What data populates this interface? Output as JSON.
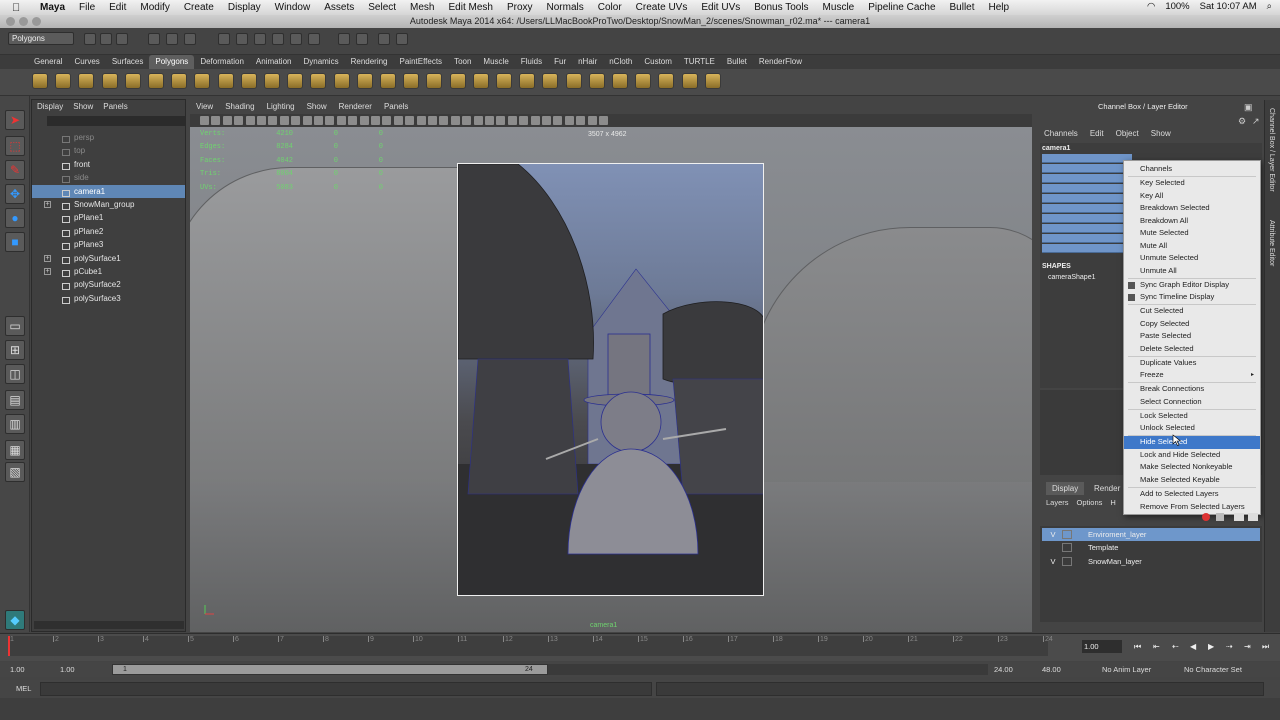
{
  "mac_menu": {
    "app": "Maya",
    "items": [
      "File",
      "Edit",
      "Modify",
      "Create",
      "Display",
      "Window",
      "Assets",
      "Select",
      "Mesh",
      "Edit Mesh",
      "Proxy",
      "Normals",
      "Color",
      "Create UVs",
      "Edit UVs",
      "Bonus Tools",
      "Muscle",
      "Pipeline Cache",
      "Bullet",
      "Help"
    ],
    "battery": "100%",
    "clock": "Sat 10:07 AM"
  },
  "window_title": "Autodesk Maya 2014 x64: /Users/LLMacBookProTwo/Desktop/SnowMan_2/scenes/Snowman_r02.ma*  ---  camera1",
  "mode_menu": "Polygons",
  "shelf_tabs": [
    "General",
    "Curves",
    "Surfaces",
    "Polygons",
    "Deformation",
    "Animation",
    "Dynamics",
    "Rendering",
    "PaintEffects",
    "Toon",
    "Muscle",
    "Fluids",
    "Fur",
    "nHair",
    "nCloth",
    "Custom",
    "TURTLE",
    "Bullet",
    "RenderFlow"
  ],
  "active_shelf_tab": "Polygons",
  "outliner": {
    "menu": [
      "Display",
      "Show",
      "Panels"
    ],
    "items": [
      {
        "label": "persp",
        "state": "dim",
        "expand": false
      },
      {
        "label": "top",
        "state": "dim",
        "expand": false
      },
      {
        "label": "front",
        "state": "normal",
        "expand": false
      },
      {
        "label": "side",
        "state": "dim",
        "expand": false
      },
      {
        "label": "camera1",
        "state": "selected",
        "expand": false
      },
      {
        "label": "SnowMan_group",
        "state": "normal",
        "expand": true
      },
      {
        "label": "pPlane1",
        "state": "normal",
        "expand": false
      },
      {
        "label": "pPlane2",
        "state": "normal",
        "expand": false
      },
      {
        "label": "pPlane3",
        "state": "normal",
        "expand": false
      },
      {
        "label": "polySurface1",
        "state": "normal",
        "expand": true
      },
      {
        "label": "pCube1",
        "state": "normal",
        "expand": true
      },
      {
        "label": "polySurface2",
        "state": "normal",
        "expand": false
      },
      {
        "label": "polySurface3",
        "state": "normal",
        "expand": false
      }
    ],
    "expand_glyph": "+"
  },
  "viewport": {
    "menu": [
      "View",
      "Shading",
      "Lighting",
      "Show",
      "Renderer",
      "Panels"
    ],
    "hud": [
      {
        "label": "Verts:",
        "v1": "4210",
        "v2": "0",
        "v3": "0"
      },
      {
        "label": "Edges:",
        "v1": "8284",
        "v2": "0",
        "v3": "0"
      },
      {
        "label": "Faces:",
        "v1": "4042",
        "v2": "0",
        "v3": "0"
      },
      {
        "label": "Tris:",
        "v1": "8004",
        "v2": "0",
        "v3": "0"
      },
      {
        "label": "UVs:",
        "v1": "5083",
        "v2": "0",
        "v3": "0"
      }
    ],
    "resolution_gate": "3507 x 4962",
    "camera_label": "camera1"
  },
  "channel_box": {
    "title": "Channel Box / Layer Editor",
    "menu": [
      "Channels",
      "Edit",
      "Object",
      "Show"
    ],
    "object_name": "camera1",
    "shapes_label": "SHAPES",
    "shape_name": "cameraShape1"
  },
  "context_menu": {
    "items": [
      {
        "label": "Channels"
      },
      {
        "label": "Key Selected"
      },
      {
        "label": "Key All"
      },
      {
        "label": "Breakdown Selected"
      },
      {
        "label": "Breakdown All"
      },
      {
        "label": "Mute Selected"
      },
      {
        "label": "Mute All"
      },
      {
        "label": "Unmute Selected"
      },
      {
        "label": "Unmute All"
      },
      {
        "label": "Sync Graph Editor Display",
        "check": true
      },
      {
        "label": "Sync Timeline Display",
        "check": true
      },
      {
        "label": "Cut Selected"
      },
      {
        "label": "Copy Selected"
      },
      {
        "label": "Paste Selected"
      },
      {
        "label": "Delete Selected"
      },
      {
        "label": "Duplicate Values"
      },
      {
        "label": "Freeze",
        "submenu": true
      },
      {
        "label": "Break Connections"
      },
      {
        "label": "Select Connection"
      },
      {
        "label": "Lock Selected"
      },
      {
        "label": "Unlock Selected"
      },
      {
        "label": "Hide Selected",
        "highlight": true
      },
      {
        "label": "Lock and Hide Selected"
      },
      {
        "label": "Make Selected Nonkeyable"
      },
      {
        "label": "Make Selected Keyable"
      },
      {
        "label": "Add to Selected Layers"
      },
      {
        "label": "Remove From Selected Layers"
      }
    ],
    "submenu_glyph": "▸"
  },
  "layer_editor": {
    "tabs": [
      "Display",
      "Render"
    ],
    "menu": [
      "Layers",
      "Options",
      "H"
    ],
    "layers": [
      {
        "visible": "V",
        "name": "Enviroment_layer",
        "selected": true
      },
      {
        "visible": "",
        "name": "Template",
        "selected": false
      },
      {
        "visible": "V",
        "name": "SnowMan_layer",
        "selected": false
      }
    ]
  },
  "side_tabs": [
    "Channel Box / Layer Editor",
    "Attribute Editor"
  ],
  "time_slider": {
    "ticks": [
      "1",
      "2",
      "3",
      "4",
      "5",
      "6",
      "7",
      "8",
      "9",
      "10",
      "11",
      "12",
      "13",
      "14",
      "15",
      "16",
      "17",
      "18",
      "19",
      "20",
      "21",
      "22",
      "23",
      "24"
    ],
    "current_frame": "1.00"
  },
  "range_slider": {
    "start": "1.00",
    "playback_start": "1.00",
    "range_handle_start": "1",
    "range_handle_end": "24",
    "playback_end": "24.00",
    "end": "48.00",
    "anim_layer": "No Anim Layer",
    "character_set": "No Character Set"
  },
  "command_line": {
    "label": "MEL"
  }
}
